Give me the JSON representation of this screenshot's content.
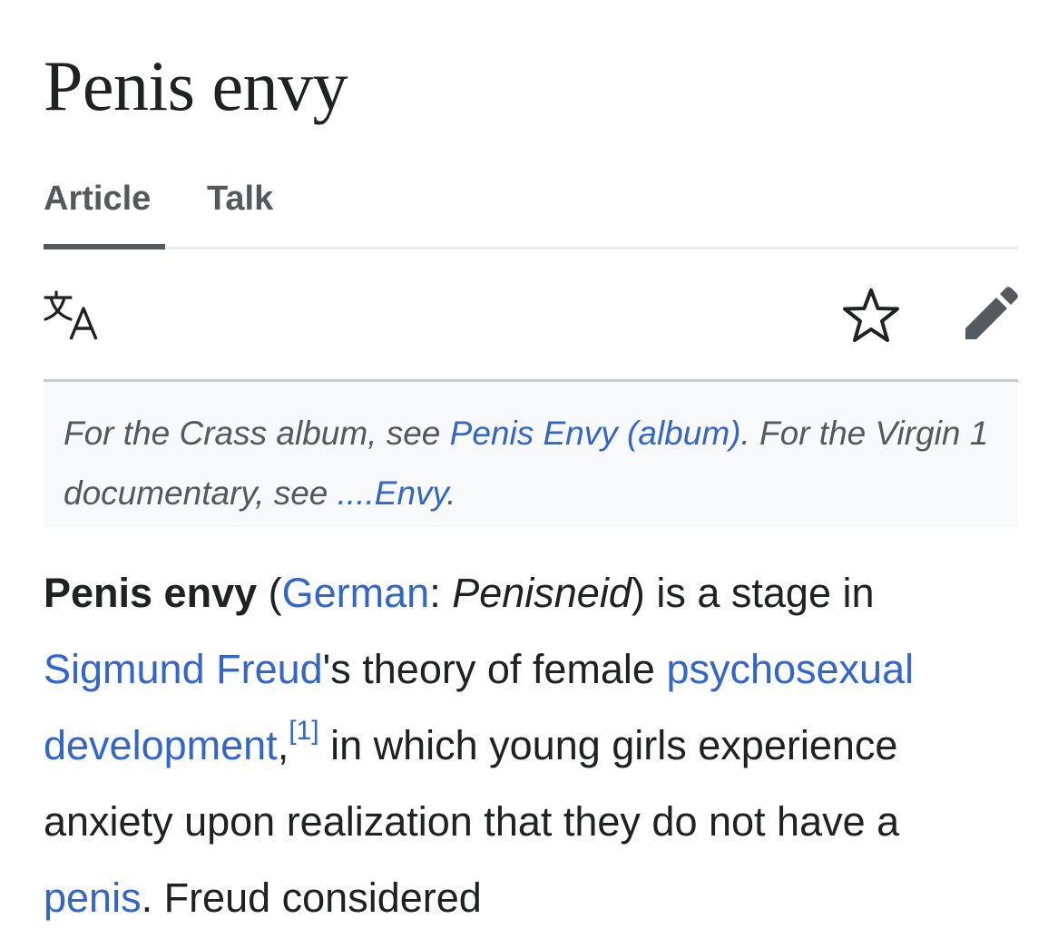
{
  "article": {
    "title": "Penis envy",
    "tabs": [
      {
        "label": "Article",
        "selected": true
      },
      {
        "label": "Talk",
        "selected": false
      }
    ],
    "actions": {
      "language_icon": "translate-icon",
      "watch_icon": "star-icon",
      "edit_icon": "pencil-icon"
    },
    "hatnote": {
      "t1": "For the Crass album, see ",
      "link1": "Penis Envy (album)",
      "t2": ". For the Virgin 1 documentary, see ",
      "link2": "....Envy",
      "t3": "."
    },
    "lead": {
      "bold": "Penis envy",
      "t1": " (",
      "link_german": "German",
      "t2": ": ",
      "italic": "Penisneid",
      "t3": ") is a stage in ",
      "link_freud": "Sigmund Freud",
      "t4": "'s theory of female ",
      "link_psycho": "psychosexual development",
      "t5": ",",
      "ref": "[1]",
      "t6": " in which young girls experience anxiety upon realization that they do not have a ",
      "link_penis": "penis",
      "t7": ". Freud considered"
    }
  },
  "colors": {
    "link": "#3366cc",
    "text": "#202122",
    "muted": "#54595d",
    "hatnote_bg": "#f8f9fa"
  }
}
